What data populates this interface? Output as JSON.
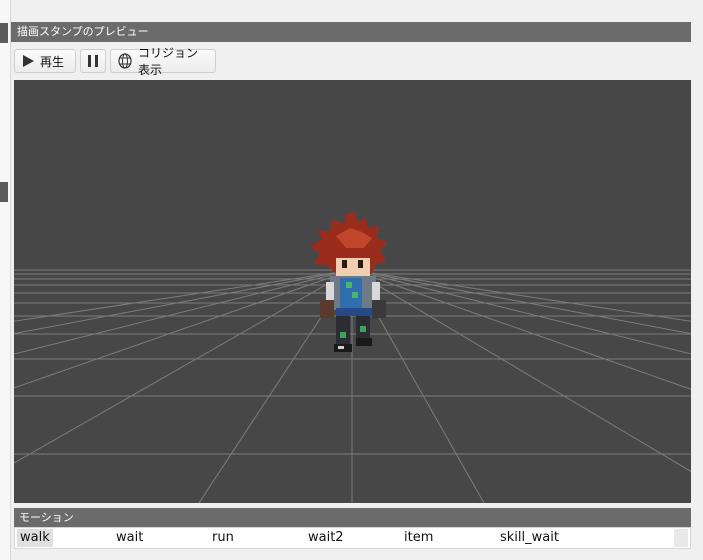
{
  "panel": {
    "title": "描画スタンプのプレビュー"
  },
  "toolbar": {
    "play_label": "再生",
    "collision_label": "コリジョン表示"
  },
  "motion": {
    "title": "モーション",
    "items": [
      "walk",
      "wait",
      "run",
      "wait2",
      "item",
      "skill_wait"
    ],
    "selected": "walk"
  },
  "icons": [
    "play-icon",
    "pause-icon",
    "collision-icon"
  ],
  "colors": {
    "viewport_bg": "#474747",
    "grid_line": "#8a8a8a",
    "header_bg": "#6b6b6b"
  }
}
